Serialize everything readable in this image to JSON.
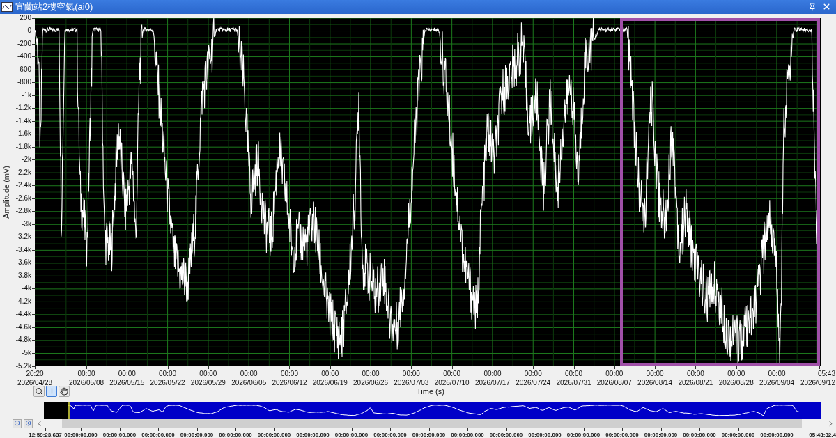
{
  "window": {
    "title": "宜蘭站2樓空氣(ai0)"
  },
  "graph": {
    "y_axis": {
      "label": "Amplitude (mV)",
      "ticks": [
        "200",
        "0",
        "-200",
        "-400",
        "-600",
        "-800",
        "-1k",
        "-1.2k",
        "-1.4k",
        "-1.6k",
        "-1.8k",
        "-2k",
        "-2.2k",
        "-2.4k",
        "-2.6k",
        "-2.8k",
        "-3k",
        "-3.2k",
        "-3.4k",
        "-3.6k",
        "-3.8k",
        "-4k",
        "-4.2k",
        "-4.4k",
        "-4.6k",
        "-4.8k",
        "-5k",
        "-5.2k"
      ]
    },
    "x_axis": {
      "label": "Time (s)",
      "ticks": [
        {
          "time": "20:20",
          "date": "2026/04/28"
        },
        {
          "time": "00:00",
          "date": "2026/05/08"
        },
        {
          "time": "00:00",
          "date": "2026/05/15"
        },
        {
          "time": "00:00",
          "date": "2026/05/22"
        },
        {
          "time": "00:00",
          "date": "2026/05/29"
        },
        {
          "time": "00:00",
          "date": "2026/06/05"
        },
        {
          "time": "00:00",
          "date": "2026/06/12"
        },
        {
          "time": "00:00",
          "date": "2026/06/19"
        },
        {
          "time": "00:00",
          "date": "2026/06/26"
        },
        {
          "time": "00:00",
          "date": "2026/07/03"
        },
        {
          "time": "00:00",
          "date": "2026/07/10"
        },
        {
          "time": "00:00",
          "date": "2026/07/17"
        },
        {
          "time": "00:00",
          "date": "2026/07/24"
        },
        {
          "time": "00:00",
          "date": "2026/07/31"
        },
        {
          "time": "00:00",
          "date": "2026/08/07"
        },
        {
          "time": "00:00",
          "date": "2026/08/14"
        },
        {
          "time": "00:00",
          "date": "2026/08/21"
        },
        {
          "time": "00:00",
          "date": "2026/08/28"
        },
        {
          "time": "00:00",
          "date": "2026/09/04"
        },
        {
          "time": "05:43",
          "date": "2026/09/12"
        }
      ]
    }
  },
  "tools": [
    {
      "kind": "zoom",
      "selected": false
    },
    {
      "kind": "cursor",
      "selected": true
    },
    {
      "kind": "pan",
      "selected": false
    }
  ],
  "overview": {
    "ticks": [
      "12:59:23.637",
      "00:00:00.000",
      "00:00:00.000",
      "00:00:00.000",
      "00:00:00.000",
      "00:00:00.000",
      "00:00:00.000",
      "00:00:00.000",
      "00:00:00.000",
      "00:00:00.000",
      "00:00:00.000",
      "00:00:00.000",
      "00:00:00.000",
      "00:00:00.000",
      "00:00:00.000",
      "00:00:00.000",
      "00:00:00.000",
      "00:00:00.000",
      "00:00:00.000",
      "00:00:00.000",
      "05:43:32.4"
    ]
  }
}
